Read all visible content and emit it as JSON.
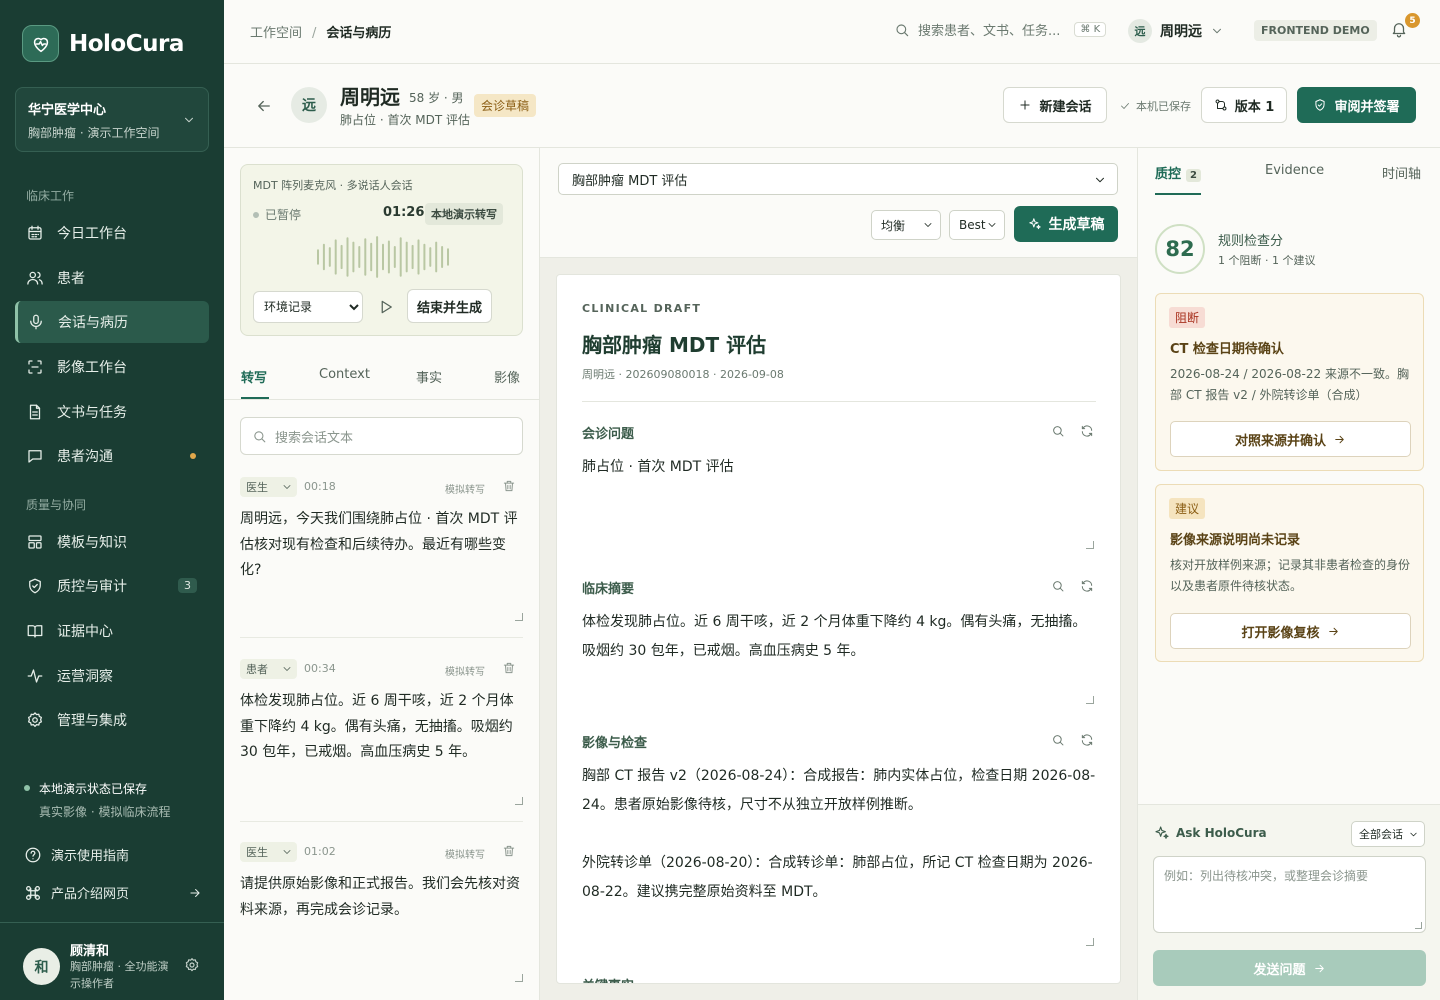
{
  "app": {
    "name": "HoloCura"
  },
  "org": {
    "name": "华宁医学中心",
    "workspace": "胸部肿瘤 · 演示工作空间"
  },
  "sidebar": {
    "section1": "临床工作",
    "section2": "质量与协同",
    "items": [
      {
        "label": "今日工作台",
        "icon": "calendar-icon"
      },
      {
        "label": "患者",
        "icon": "users-icon"
      },
      {
        "label": "会话与病历",
        "icon": "mic-icon",
        "active": true
      },
      {
        "label": "影像工作台",
        "icon": "scan-icon"
      },
      {
        "label": "文书与任务",
        "icon": "document-icon"
      },
      {
        "label": "患者沟通",
        "icon": "chat-icon",
        "dot": true
      },
      {
        "label": "模板与知识",
        "icon": "layout-icon"
      },
      {
        "label": "质控与审计",
        "icon": "shield-icon",
        "badge": "3"
      },
      {
        "label": "证据中心",
        "icon": "book-icon"
      },
      {
        "label": "运营洞察",
        "icon": "activity-icon"
      },
      {
        "label": "管理与集成",
        "icon": "gear-icon"
      }
    ],
    "save_status": "本地演示状态已保存",
    "save_sub": "真实影像 · 模拟临床流程",
    "guide": "演示使用指南",
    "product": "产品介绍网页",
    "user": {
      "avatar": "和",
      "name": "顾清和",
      "role": "胸部肿瘤 · 全功能演示操作者"
    }
  },
  "topbar": {
    "crumb_root": "工作空间",
    "crumb_sep": "/",
    "crumb_current": "会话与病历",
    "search_placeholder": "搜索患者、文书、任务...",
    "search_kbd": "⌘ K",
    "user_avatar": "远",
    "user_name": "周明远",
    "demo_badge": "FRONTEND DEMO",
    "notif_count": "5"
  },
  "patient": {
    "avatar": "远",
    "name": "周明远",
    "meta": "58 岁 · 男",
    "sub": "肺占位 · 首次 MDT 评估",
    "status": "会诊草稿",
    "new_session": "新建会话",
    "saved": "本机已保存",
    "version": "版本 1",
    "sign": "审阅并签署"
  },
  "recorder": {
    "title": "MDT 阵列麦克风 · 多说话人会话",
    "status": "已暂停",
    "time": "01:26",
    "local_tag": "本地演示转写",
    "mode": "环境记录",
    "end_btn": "结束并生成",
    "waveform": [
      0.35,
      0.6,
      0.45,
      0.8,
      0.55,
      0.9,
      0.7,
      0.5,
      0.85,
      0.65,
      0.95,
      0.6,
      0.75,
      0.5,
      0.9,
      0.7,
      0.55,
      0.8,
      0.6,
      0.45,
      0.7,
      0.5,
      0.4
    ]
  },
  "left_tabs": [
    "转写",
    "Context",
    "事实",
    "影像"
  ],
  "transcript_search_placeholder": "搜索会话文本",
  "transcript": [
    {
      "role": "医生",
      "time": "00:18",
      "sim": "模拟转写",
      "text": "周明远，今天我们围绕肺占位 · 首次 MDT 评估核对现有检查和后续待办。最近有哪些变化?"
    },
    {
      "role": "患者",
      "time": "00:34",
      "sim": "模拟转写",
      "text": "体检发现肺占位。近 6 周干咳，近 2 个月体重下降约 4 kg。偶有头痛，无抽搐。吸烟约 30 包年，已戒烟。高血压病史 5 年。"
    },
    {
      "role": "医生",
      "time": "01:02",
      "sim": "模拟转写",
      "text": "请提供原始影像和正式报告。我们会先核对资料来源，再完成会诊记录。"
    }
  ],
  "center": {
    "template": "胸部肿瘤 MDT 评估",
    "mode": "均衡",
    "model": "Best",
    "generate": "生成草稿",
    "doc": {
      "eyebrow": "CLINICAL DRAFT",
      "title": "胸部肿瘤 MDT 评估",
      "meta": "周明远 · 202609080018 · 2026-09-08",
      "sections": [
        {
          "heading": "会诊问题",
          "body": "肺占位 · 首次 MDT 评估"
        },
        {
          "heading": "临床摘要",
          "body": "体检发现肺占位。近 6 周干咳，近 2 个月体重下降约 4 kg。偶有头痛，无抽搐。吸烟约 30 包年，已戒烟。高血压病史 5 年。"
        },
        {
          "heading": "影像与检查",
          "body": "胸部 CT 报告 v2（2026-08-24）：合成报告：肺内实体占位，检查日期 2026-08-24。患者原始影像待核，尺寸不从独立开放样例推断。\n\n外院转诊单（2026-08-20）：合成转诊单：肺部占位，所记 CT 检查日期为 2026-08-22。建议携完整原始资料至 MDT。"
        },
        {
          "heading": "关键事实",
          "body": ""
        }
      ]
    }
  },
  "right": {
    "tabs": [
      "质控",
      "Evidence",
      "时间轴"
    ],
    "qc_count": "2",
    "score": "82",
    "score_title": "规则检查分",
    "score_sub": "1 个阻断 · 1 个建议",
    "cards": [
      {
        "tag": "阻断",
        "title": "CT 检查日期待确认",
        "body": "2026-08-24 / 2026-08-22 来源不一致。胸部 CT 报告 v2 / 外院转诊单（合成）",
        "action": "对照来源并确认"
      },
      {
        "tag": "建议",
        "title": "影像来源说明尚未记录",
        "body": "核对开放样例来源；记录其非患者检查的身份以及患者原件待核状态。",
        "action": "打开影像复核"
      }
    ],
    "ask": {
      "title": "Ask HoloCura",
      "scope": "全部会话",
      "placeholder": "例如：列出待核冲突，或整理会诊摘要",
      "send": "发送问题"
    }
  },
  "colors": {
    "sidebar": "#1a3d33",
    "primary": "#1f6b57",
    "warning": "#d9972e",
    "block_tag": "#a8321f",
    "suggest_tag": "#8b5e14"
  }
}
